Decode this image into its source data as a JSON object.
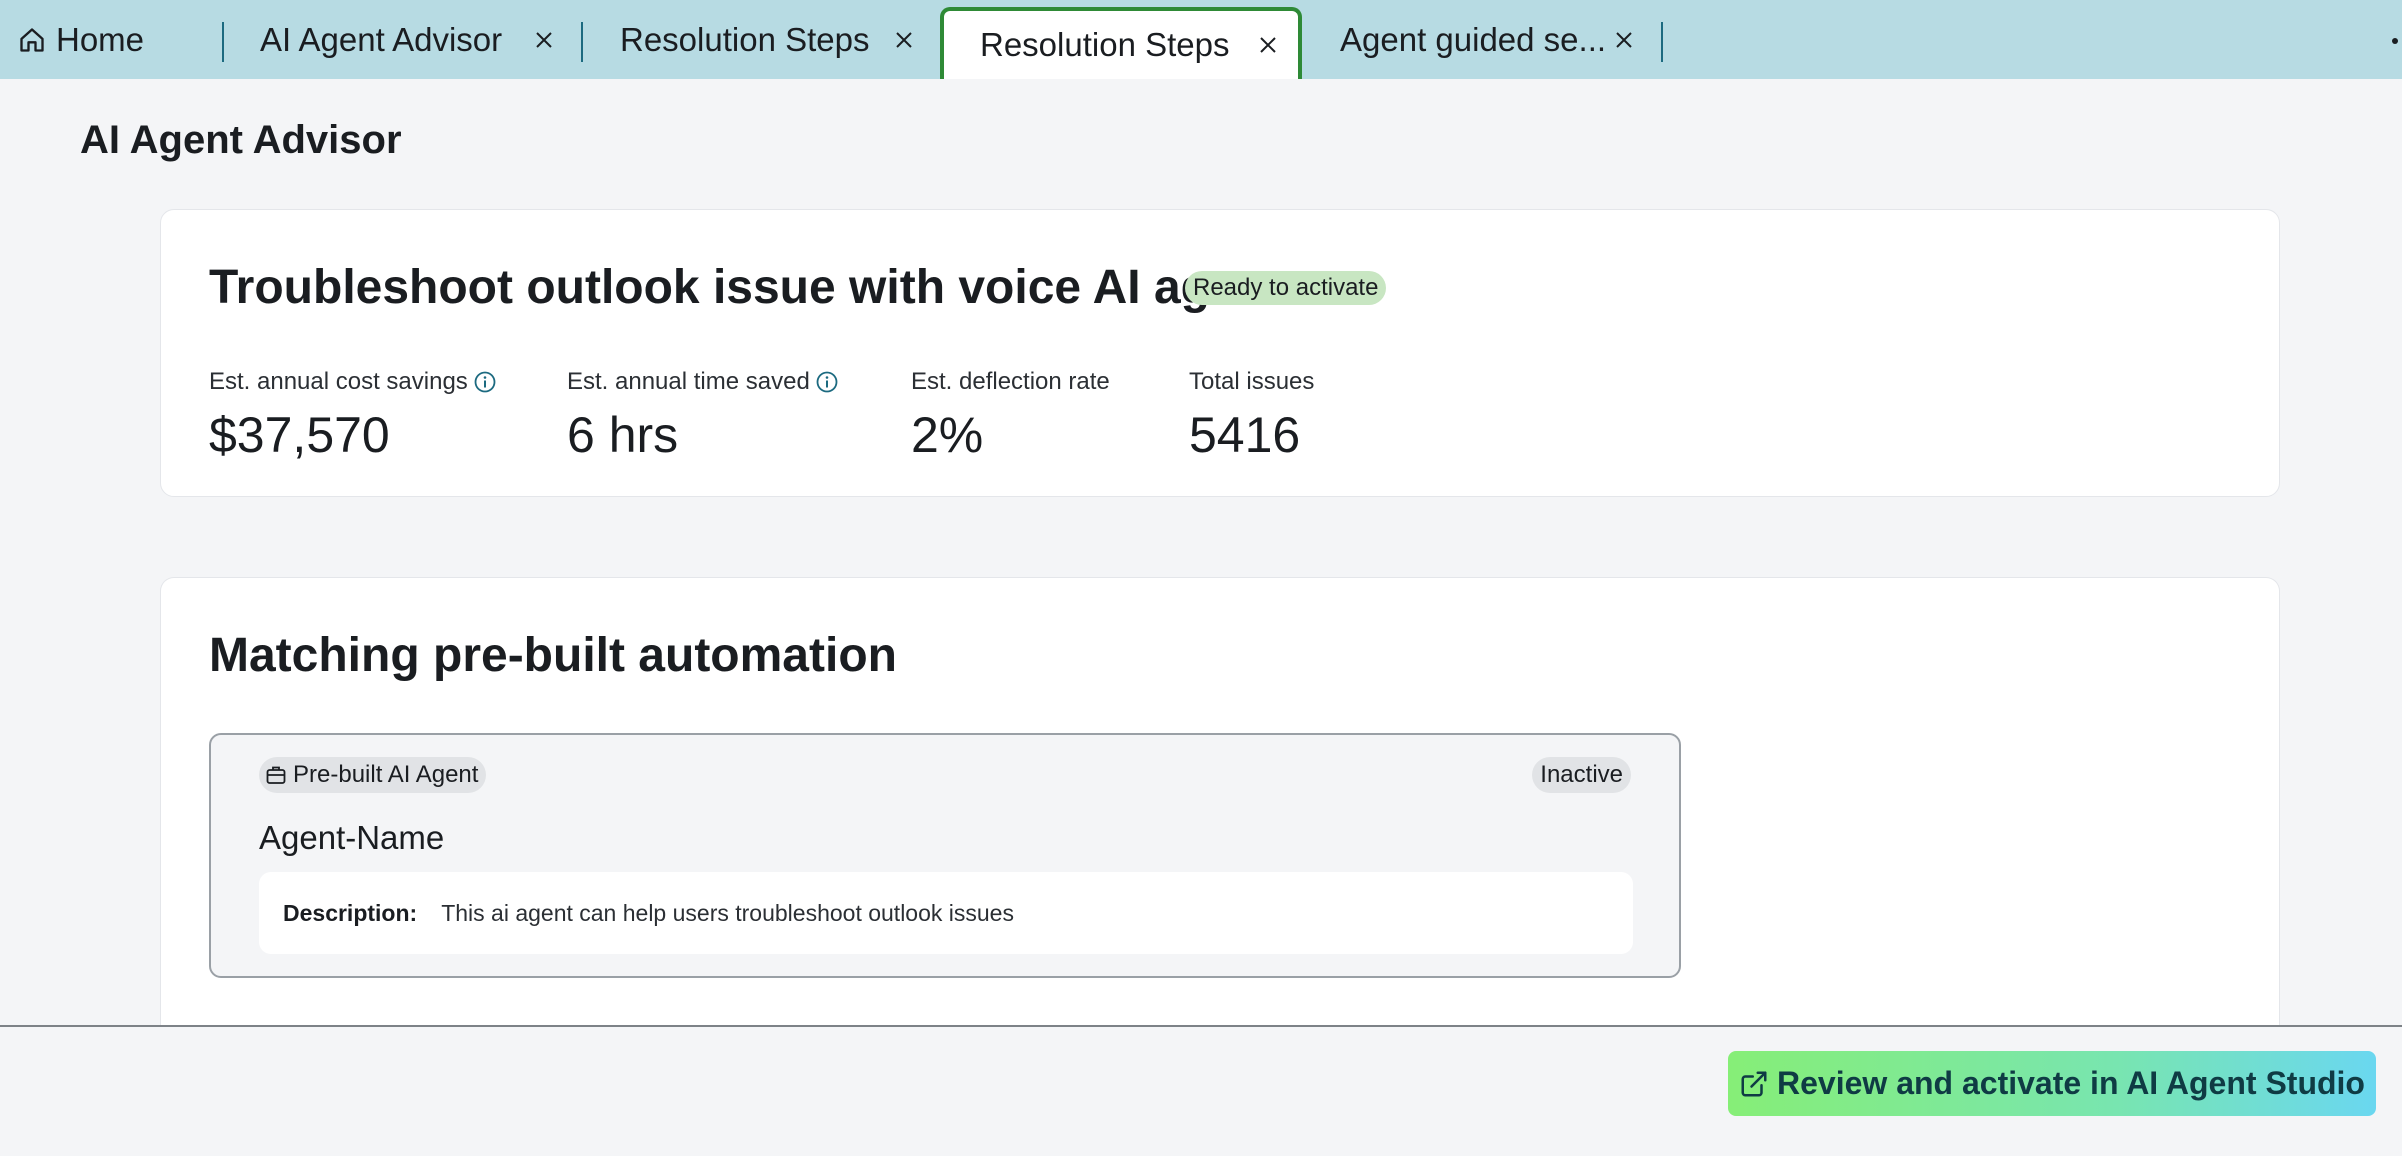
{
  "tabs": {
    "home": {
      "label": "Home",
      "icon": "home-icon"
    },
    "items": [
      {
        "label": "AI Agent Advisor"
      },
      {
        "label": "Resolution Steps"
      },
      {
        "label": "Resolution Steps"
      },
      {
        "label": "Agent guided se..."
      }
    ],
    "active_index": 2
  },
  "page": {
    "title": "AI Agent Advisor"
  },
  "summary_card": {
    "title": "Troubleshoot outlook issue with voice AI agent",
    "status": "Ready to activate",
    "metrics": [
      {
        "label": "Est. annual cost savings",
        "value": "$37,570",
        "has_info": true
      },
      {
        "label": "Est. annual time saved",
        "value": "6 hrs",
        "has_info": true
      },
      {
        "label": "Est. deflection rate",
        "value": "2%",
        "has_info": false
      },
      {
        "label": "Total issues",
        "value": "5416",
        "has_info": false
      }
    ]
  },
  "automation_card": {
    "title": "Matching pre-built automation",
    "agent": {
      "type_badge": "Pre-built AI Agent",
      "status": "Inactive",
      "name": "Agent-Name",
      "description_label": "Description:",
      "description": "This ai agent can help users troubleshoot outlook issues"
    }
  },
  "footer": {
    "activate_label": "Review and activate in AI Agent Studio"
  },
  "colors": {
    "tabbar_bg": "#b7dbe3",
    "active_tab_border": "#2e8a36",
    "ready_badge_bg": "#c8e6c2",
    "info_icon": "#1c6a80"
  }
}
